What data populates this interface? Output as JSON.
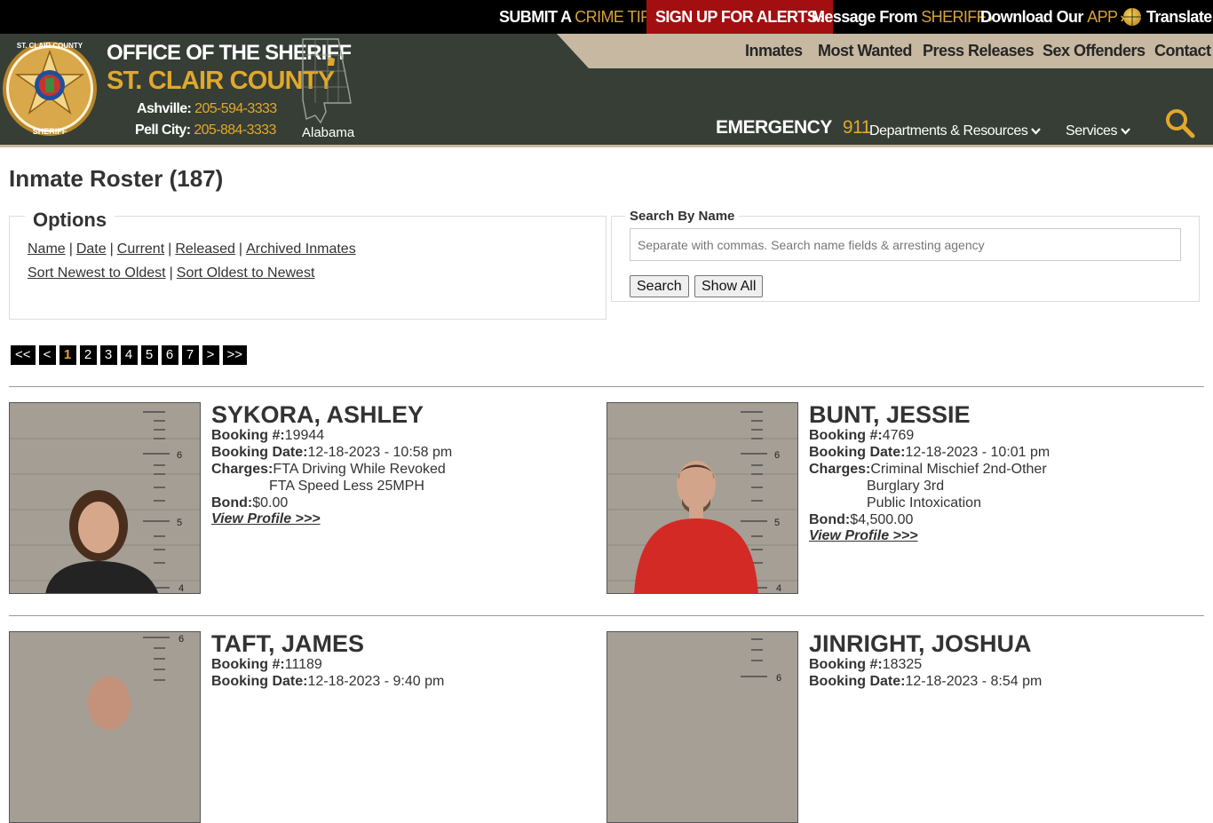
{
  "topbar": {
    "crime_tip_a": "SUBMIT A",
    "crime_tip_b": "CRIME TIP",
    "alerts": "SIGN UP FOR ALERTS",
    "message_a": "Message From",
    "message_b": "SHERIFF",
    "download_a": "Download Our",
    "download_b": "APP",
    "translate": "Translate",
    "chevron": "›"
  },
  "header": {
    "title1": "OFFICE OF THE SHERIFF",
    "title2": "ST. CLAIR COUNTY",
    "phone1_label": "Ashville:",
    "phone1_num": "205-594-3333",
    "phone2_label": "Pell City:",
    "phone2_num": "205-884-3333",
    "state": "Alabama",
    "badge_text_top": "ST. CLAIR COUNTY",
    "badge_text_bottom": "SHERIFF",
    "nav": [
      "Inmates",
      "Most Wanted",
      "Press Releases",
      "Sex Offenders",
      "Contact"
    ],
    "emergency_label": "EMERGENCY",
    "emergency_num": "911",
    "dropdowns": [
      "Departments & Resources",
      "Services"
    ],
    "caret": "⌄"
  },
  "page": {
    "title": "Inmate Roster (187)"
  },
  "options": {
    "legend": "Options",
    "filters": [
      "Name",
      "Date",
      "Current",
      "Released",
      "Archived Inmates"
    ],
    "sorts": [
      "Sort Newest to Oldest",
      "Sort Oldest to Newest"
    ],
    "separator": "|"
  },
  "search": {
    "legend": "Search By Name",
    "placeholder": "Separate with commas. Search name fields & arresting agency",
    "search_btn": "Search",
    "show_all_btn": "Show All"
  },
  "pagination": {
    "first": "<<",
    "prev": "<",
    "pages": [
      "1",
      "2",
      "3",
      "4",
      "5",
      "6",
      "7"
    ],
    "active": "1",
    "next": ">",
    "last": ">>"
  },
  "labels": {
    "booking_no": "Booking #:",
    "booking_date": "Booking Date:",
    "charges": "Charges:",
    "bond": "Bond:",
    "view_profile": "View Profile >>>"
  },
  "inmates": [
    {
      "name": "SYKORA, ASHLEY",
      "booking_no": "19944",
      "booking_date": "12-18-2023 - 10:58 pm",
      "charges": [
        "FTA Driving While Revoked",
        "FTA Speed Less 25MPH"
      ],
      "bond": "$0.00",
      "height_marks": [
        "6",
        "5",
        "4"
      ]
    },
    {
      "name": "BUNT, JESSIE",
      "booking_no": "4769",
      "booking_date": "12-18-2023 - 10:01 pm",
      "charges": [
        "Criminal Mischief 2nd-Other",
        "Burglary 3rd",
        "Public Intoxication"
      ],
      "bond": "$4,500.00",
      "height_marks": [
        "6",
        "5",
        "4"
      ]
    },
    {
      "name": "TAFT, JAMES",
      "booking_no": "11189",
      "booking_date": "12-18-2023 - 9:40 pm",
      "height_marks": [
        "6"
      ]
    },
    {
      "name": "JINRIGHT, JOSHUA",
      "booking_no": "18325",
      "booking_date": "12-18-2023 - 8:54 pm",
      "height_marks": [
        "6"
      ]
    }
  ],
  "colors": {
    "topbar": "#000000",
    "header": "#363e36",
    "gold": "#e2a82b",
    "alert_red": "#a30f10",
    "nav_band": "#c6b8a1"
  }
}
